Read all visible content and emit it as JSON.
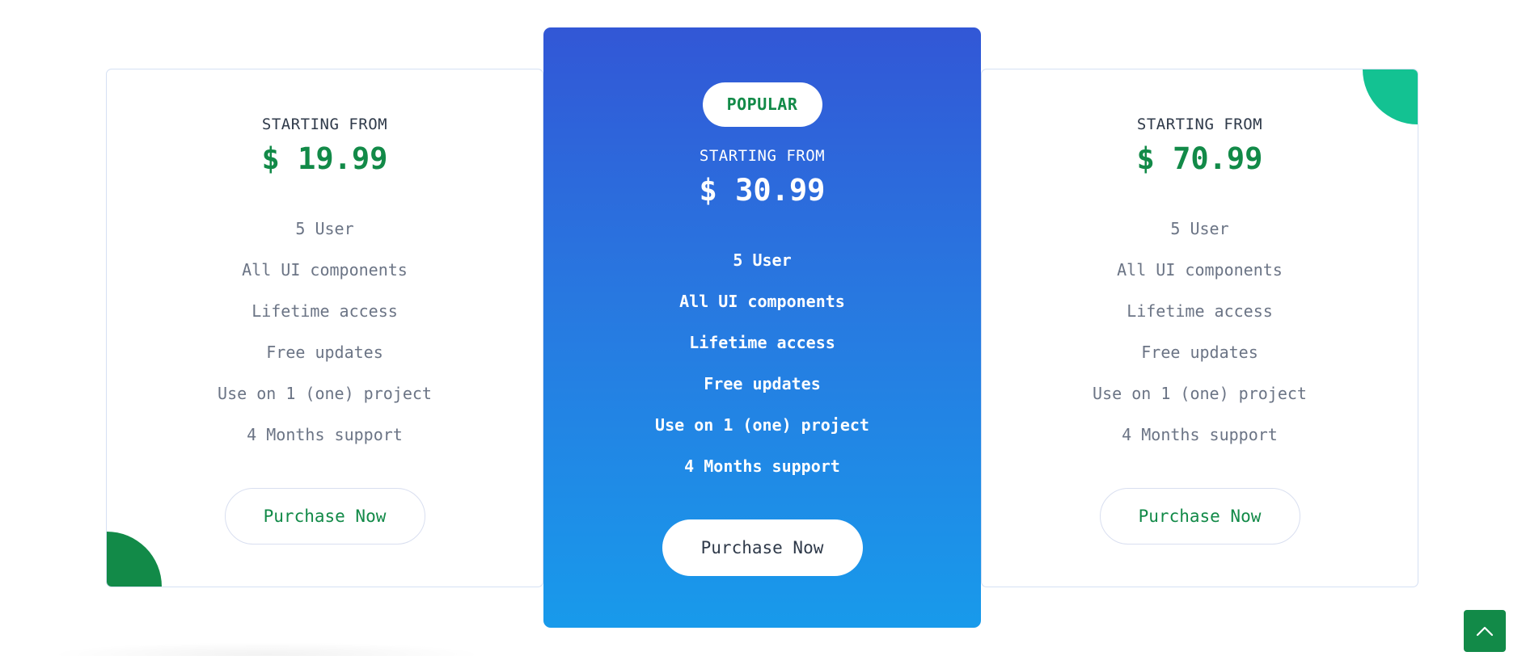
{
  "colors": {
    "accent": "#128a48",
    "accent_light": "#13c292",
    "featured_gradient_top": "#3257d6",
    "featured_gradient_bottom": "#189aeb",
    "card_border": "#d5e0f3",
    "muted_text": "#6b7485"
  },
  "plans": [
    {
      "starting_label": "STARTING FROM",
      "price": "$ 19.99",
      "features": [
        "5 User",
        "All UI components",
        "Lifetime access",
        "Free updates",
        "Use on 1 (one) project",
        "4 Months support"
      ],
      "button_label": "Purchase Now"
    },
    {
      "badge": "POPULAR",
      "starting_label": "STARTING FROM",
      "price": "$ 30.99",
      "features": [
        "5 User",
        "All UI components",
        "Lifetime access",
        "Free updates",
        "Use on 1 (one) project",
        "4 Months support"
      ],
      "button_label": "Purchase Now"
    },
    {
      "starting_label": "STARTING FROM",
      "price": "$ 70.99",
      "features": [
        "5 User",
        "All UI components",
        "Lifetime access",
        "Free updates",
        "Use on 1 (one) project",
        "4 Months support"
      ],
      "button_label": "Purchase Now"
    }
  ],
  "scroll_top": {
    "icon": "chevron-up-icon"
  }
}
